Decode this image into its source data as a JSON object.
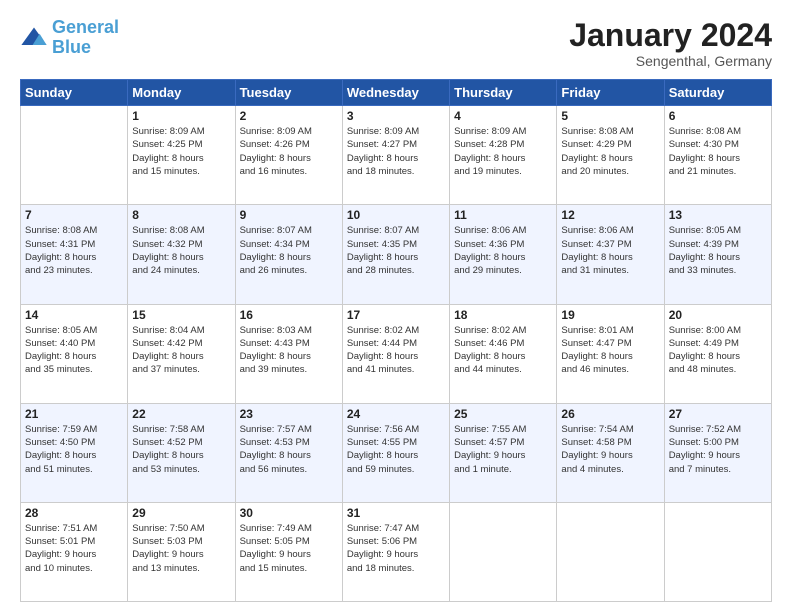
{
  "logo": {
    "text_general": "General",
    "text_blue": "Blue"
  },
  "header": {
    "month": "January 2024",
    "location": "Sengenthal, Germany"
  },
  "days_of_week": [
    "Sunday",
    "Monday",
    "Tuesday",
    "Wednesday",
    "Thursday",
    "Friday",
    "Saturday"
  ],
  "weeks": [
    [
      {
        "day": "",
        "info": ""
      },
      {
        "day": "1",
        "info": "Sunrise: 8:09 AM\nSunset: 4:25 PM\nDaylight: 8 hours\nand 15 minutes."
      },
      {
        "day": "2",
        "info": "Sunrise: 8:09 AM\nSunset: 4:26 PM\nDaylight: 8 hours\nand 16 minutes."
      },
      {
        "day": "3",
        "info": "Sunrise: 8:09 AM\nSunset: 4:27 PM\nDaylight: 8 hours\nand 18 minutes."
      },
      {
        "day": "4",
        "info": "Sunrise: 8:09 AM\nSunset: 4:28 PM\nDaylight: 8 hours\nand 19 minutes."
      },
      {
        "day": "5",
        "info": "Sunrise: 8:08 AM\nSunset: 4:29 PM\nDaylight: 8 hours\nand 20 minutes."
      },
      {
        "day": "6",
        "info": "Sunrise: 8:08 AM\nSunset: 4:30 PM\nDaylight: 8 hours\nand 21 minutes."
      }
    ],
    [
      {
        "day": "7",
        "info": "Sunrise: 8:08 AM\nSunset: 4:31 PM\nDaylight: 8 hours\nand 23 minutes."
      },
      {
        "day": "8",
        "info": "Sunrise: 8:08 AM\nSunset: 4:32 PM\nDaylight: 8 hours\nand 24 minutes."
      },
      {
        "day": "9",
        "info": "Sunrise: 8:07 AM\nSunset: 4:34 PM\nDaylight: 8 hours\nand 26 minutes."
      },
      {
        "day": "10",
        "info": "Sunrise: 8:07 AM\nSunset: 4:35 PM\nDaylight: 8 hours\nand 28 minutes."
      },
      {
        "day": "11",
        "info": "Sunrise: 8:06 AM\nSunset: 4:36 PM\nDaylight: 8 hours\nand 29 minutes."
      },
      {
        "day": "12",
        "info": "Sunrise: 8:06 AM\nSunset: 4:37 PM\nDaylight: 8 hours\nand 31 minutes."
      },
      {
        "day": "13",
        "info": "Sunrise: 8:05 AM\nSunset: 4:39 PM\nDaylight: 8 hours\nand 33 minutes."
      }
    ],
    [
      {
        "day": "14",
        "info": "Sunrise: 8:05 AM\nSunset: 4:40 PM\nDaylight: 8 hours\nand 35 minutes."
      },
      {
        "day": "15",
        "info": "Sunrise: 8:04 AM\nSunset: 4:42 PM\nDaylight: 8 hours\nand 37 minutes."
      },
      {
        "day": "16",
        "info": "Sunrise: 8:03 AM\nSunset: 4:43 PM\nDaylight: 8 hours\nand 39 minutes."
      },
      {
        "day": "17",
        "info": "Sunrise: 8:02 AM\nSunset: 4:44 PM\nDaylight: 8 hours\nand 41 minutes."
      },
      {
        "day": "18",
        "info": "Sunrise: 8:02 AM\nSunset: 4:46 PM\nDaylight: 8 hours\nand 44 minutes."
      },
      {
        "day": "19",
        "info": "Sunrise: 8:01 AM\nSunset: 4:47 PM\nDaylight: 8 hours\nand 46 minutes."
      },
      {
        "day": "20",
        "info": "Sunrise: 8:00 AM\nSunset: 4:49 PM\nDaylight: 8 hours\nand 48 minutes."
      }
    ],
    [
      {
        "day": "21",
        "info": "Sunrise: 7:59 AM\nSunset: 4:50 PM\nDaylight: 8 hours\nand 51 minutes."
      },
      {
        "day": "22",
        "info": "Sunrise: 7:58 AM\nSunset: 4:52 PM\nDaylight: 8 hours\nand 53 minutes."
      },
      {
        "day": "23",
        "info": "Sunrise: 7:57 AM\nSunset: 4:53 PM\nDaylight: 8 hours\nand 56 minutes."
      },
      {
        "day": "24",
        "info": "Sunrise: 7:56 AM\nSunset: 4:55 PM\nDaylight: 8 hours\nand 59 minutes."
      },
      {
        "day": "25",
        "info": "Sunrise: 7:55 AM\nSunset: 4:57 PM\nDaylight: 9 hours\nand 1 minute."
      },
      {
        "day": "26",
        "info": "Sunrise: 7:54 AM\nSunset: 4:58 PM\nDaylight: 9 hours\nand 4 minutes."
      },
      {
        "day": "27",
        "info": "Sunrise: 7:52 AM\nSunset: 5:00 PM\nDaylight: 9 hours\nand 7 minutes."
      }
    ],
    [
      {
        "day": "28",
        "info": "Sunrise: 7:51 AM\nSunset: 5:01 PM\nDaylight: 9 hours\nand 10 minutes."
      },
      {
        "day": "29",
        "info": "Sunrise: 7:50 AM\nSunset: 5:03 PM\nDaylight: 9 hours\nand 13 minutes."
      },
      {
        "day": "30",
        "info": "Sunrise: 7:49 AM\nSunset: 5:05 PM\nDaylight: 9 hours\nand 15 minutes."
      },
      {
        "day": "31",
        "info": "Sunrise: 7:47 AM\nSunset: 5:06 PM\nDaylight: 9 hours\nand 18 minutes."
      },
      {
        "day": "",
        "info": ""
      },
      {
        "day": "",
        "info": ""
      },
      {
        "day": "",
        "info": ""
      }
    ]
  ]
}
